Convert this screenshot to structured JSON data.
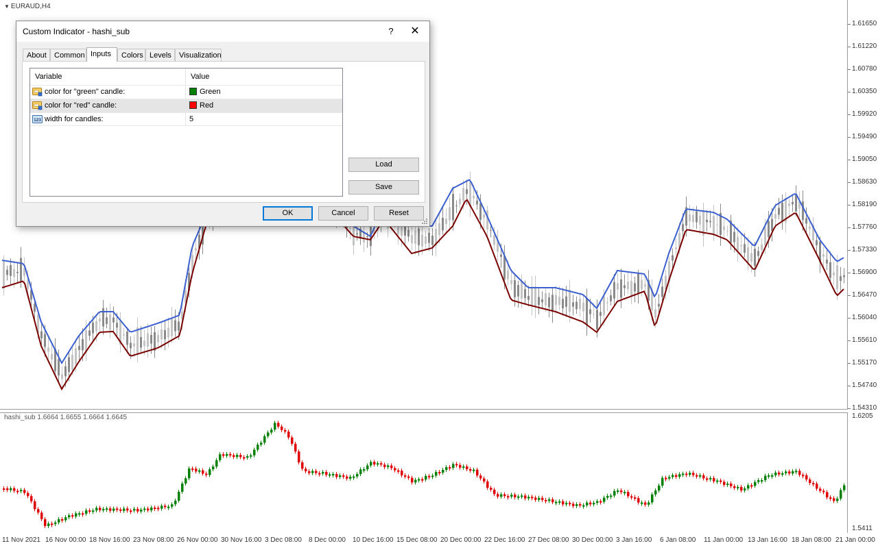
{
  "main_chart": {
    "symbol_label": "EURAUD,H4",
    "price_labels": [
      "1.61650",
      "1.61220",
      "1.60780",
      "1.60350",
      "1.59920",
      "1.59490",
      "1.59050",
      "1.58630",
      "1.58190",
      "1.57760",
      "1.57330",
      "1.56900",
      "1.56470",
      "1.56040",
      "1.55610",
      "1.55170",
      "1.54740",
      "1.54310"
    ],
    "colors": {
      "ma_upper": "#3a5fd0",
      "ma_lower": "#7a0000",
      "candle": "#8a8a8a",
      "candle_light": "#c4c4c4"
    }
  },
  "sub_chart": {
    "title": "hashi_sub 1.6664 1.6655 1.6664 1.6645",
    "price_labels": [
      "1.6205",
      "1.5411"
    ],
    "colors": {
      "bull": "#008000",
      "bear": "#e00000"
    }
  },
  "time_axis": {
    "labels": [
      "11 Nov 2021",
      "16 Nov 00:00",
      "18 Nov 16:00",
      "23 Nov 08:00",
      "26 Nov 00:00",
      "30 Nov 16:00",
      "3 Dec 08:00",
      "8 Dec 00:00",
      "10 Dec 16:00",
      "15 Dec 08:00",
      "20 Dec 00:00",
      "22 Dec 16:00",
      "27 Dec 08:00",
      "30 Dec 00:00",
      "3 Jan 16:00",
      "6 Jan 08:00",
      "11 Jan 00:00",
      "13 Jan 16:00",
      "18 Jan 08:00",
      "21 Jan 00:00"
    ]
  },
  "dialog": {
    "title": "Custom Indicator - hashi_sub",
    "help_glyph": "?",
    "close_glyph": "✕",
    "tabs": [
      {
        "label": "About"
      },
      {
        "label": "Common"
      },
      {
        "label": "Inputs"
      },
      {
        "label": "Colors"
      },
      {
        "label": "Levels"
      },
      {
        "label": "Visualization"
      }
    ],
    "active_tab": "Inputs",
    "table": {
      "headers": {
        "variable": "Variable",
        "value": "Value"
      },
      "rows": [
        {
          "variable": "color for \"green\" candle:",
          "value": "Green",
          "swatch": "#008000",
          "icon": "color-param-icon"
        },
        {
          "variable": "color for \"red\" candle:",
          "value": "Red",
          "swatch": "#ff0000",
          "icon": "color-param-icon"
        },
        {
          "variable": "width for candles:",
          "value": "5",
          "icon": "integer-param-icon"
        }
      ]
    },
    "buttons": {
      "load": "Load",
      "save": "Save",
      "ok": "OK",
      "cancel": "Cancel",
      "reset": "Reset"
    }
  }
}
